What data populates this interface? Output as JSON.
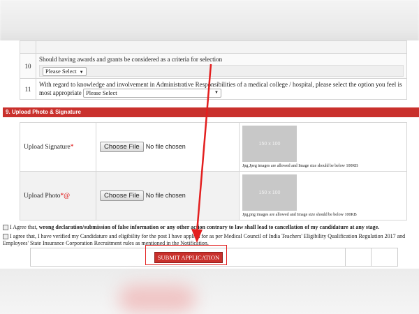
{
  "questions": [
    {
      "num": "10",
      "text": "Should having awards and grants be considered as a criteria for selection",
      "select": "Please Select"
    },
    {
      "num": "11",
      "text": "With regard to knowledge and involvement in Administrative Responsibilities of a medical college / hospital, please select the option you feel is most appropriate",
      "select": "Please Select"
    }
  ],
  "section_title": "9. Upload Photo & Signature",
  "uploads": [
    {
      "label": "Upload Signature",
      "req": "*",
      "button": "Choose File",
      "file": "No file chosen",
      "placeholder": "150 x 100",
      "note": "Jpg,Jpeg images are allowed and Image size should be below 100KB"
    },
    {
      "label": "Upload Photo",
      "req": "*@",
      "button": "Choose File",
      "file": "No file chosen",
      "placeholder": "150 x 100",
      "note": "Jpg,png images are allowed and Image size should be below 100KB"
    }
  ],
  "agreements": {
    "first_prefix": "I Agree that, ",
    "first_bold": "wrong declaration/submission of false information or any other action contrary to law shall lead to cancellation of my candidature at any stage.",
    "second": "I agree that, I have verified my Candidature and eligibility for the post I have applied for as per Medical Council of India Teachers' Eligibility Qualification Regulation 2017 and Employees' State Insurance Corporation Recruitment rules as mentioned in the Notification."
  },
  "submit_label": "SUBMIT APPLICATION",
  "colors": {
    "accent": "#c9302c",
    "annotation": "#e31f1f"
  }
}
